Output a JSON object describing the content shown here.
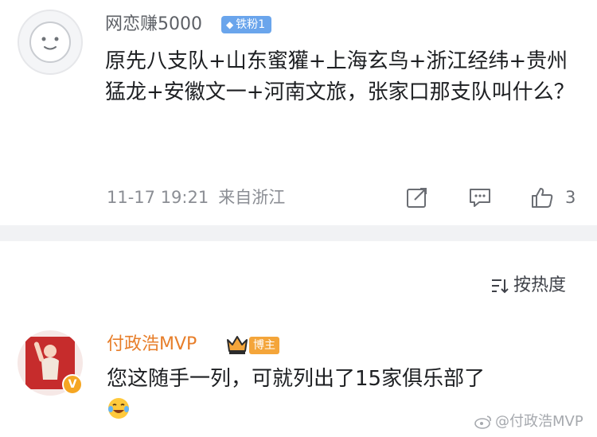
{
  "comment1": {
    "username": "网恋赚5000",
    "fan_badge": {
      "label": "铁粉1",
      "color": "#6aa5ec"
    },
    "text": "原先八支队+山东蜜獾+上海玄鸟+浙江经纬+贵州猛龙+安徽文一+河南文旅，张家口那支队叫什么？",
    "timestamp": "11-17 19:21",
    "location": "来自浙江",
    "likes": "3",
    "icons": [
      "share-icon",
      "reply-icon",
      "like-icon"
    ]
  },
  "sort": {
    "label": "按热度",
    "icon": "sort-icon"
  },
  "comment2": {
    "username": "付政浩MVP",
    "host_badge": "博主",
    "text": "您这随手一列，可就列出了15家俱乐部了",
    "emoji": "laughing-tears-emoji",
    "name_color": "#e77e2a"
  },
  "watermark": {
    "text": "@付政浩MVP"
  }
}
